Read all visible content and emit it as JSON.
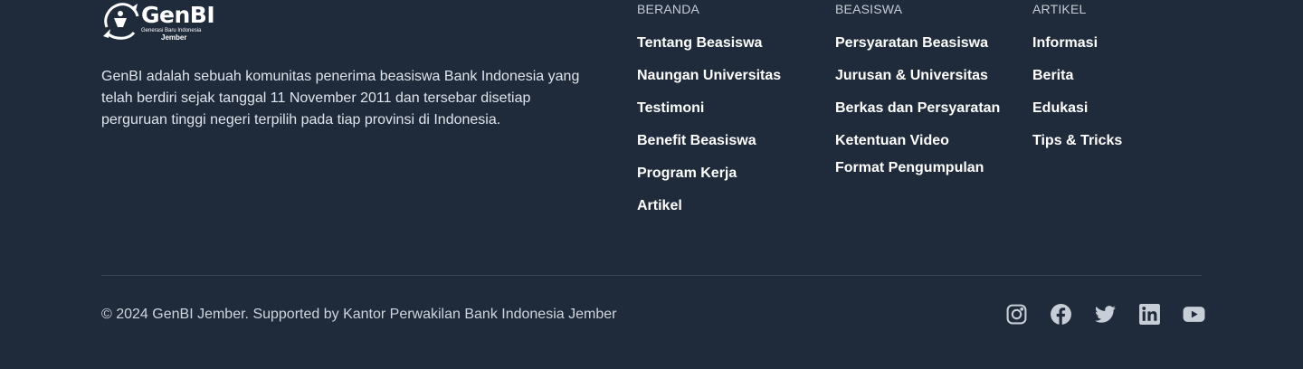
{
  "logo": {
    "main": "GenBI",
    "sub": "Generasi Baru Indonesia",
    "region": "Jember"
  },
  "description": "GenBI adalah sebuah komunitas penerima beasiswa Bank Indonesia yang telah berdiri sejak tanggal 11 November 2011 dan tersebar disetiap perguruan tinggi negeri terpilih pada tiap provinsi di Indonesia.",
  "columns": [
    {
      "heading": "BERANDA",
      "links": [
        "Tentang Beasiswa",
        "Naungan Universitas",
        "Testimoni",
        "Benefit Beasiswa",
        "Program Kerja",
        "Artikel"
      ]
    },
    {
      "heading": "BEASISWA",
      "links": [
        "Persyaratan Beasiswa",
        "Jurusan & Universitas",
        "Berkas dan Persyaratan",
        "Ketentuan Video",
        "Format Pengumpulan"
      ]
    },
    {
      "heading": "ARTIKEL",
      "links": [
        "Informasi",
        "Berita",
        "Edukasi",
        "Tips & Tricks"
      ]
    }
  ],
  "footer": {
    "copyright": "© 2024 GenBI Jember. Supported by Kantor Perwakilan Bank Indonesia Jember"
  },
  "socials": [
    {
      "name": "instagram-icon"
    },
    {
      "name": "facebook-icon"
    },
    {
      "name": "twitter-icon"
    },
    {
      "name": "linkedin-icon"
    },
    {
      "name": "youtube-icon"
    }
  ],
  "colors": {
    "background": "#1f2a3b",
    "icon": "#c8ced8",
    "text": "#ffffff"
  }
}
